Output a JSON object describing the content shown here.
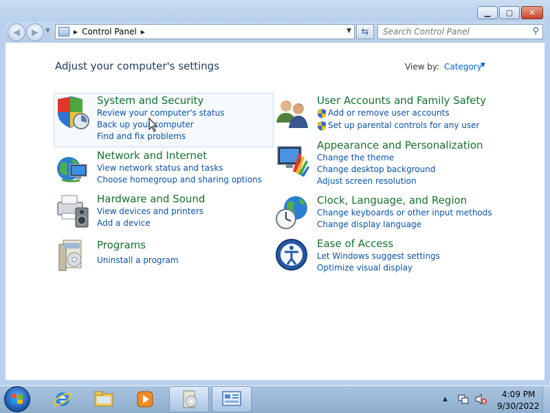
{
  "window": {
    "minimize_glyph": "▁",
    "maximize_glyph": "▢",
    "close_glyph": "✕"
  },
  "nav": {
    "breadcrumb": "Control Panel",
    "search_placeholder": "Search Control Panel"
  },
  "page": {
    "title": "Adjust your computer's settings",
    "view_by_label": "View by:",
    "view_by_value": "Category"
  },
  "categories": [
    {
      "title": "System and Security",
      "links": [
        "Review your computer's status",
        "Back up your computer",
        "Find and fix problems"
      ]
    },
    {
      "title": "Network and Internet",
      "links": [
        "View network status and tasks",
        "Choose homegroup and sharing options"
      ]
    },
    {
      "title": "Hardware and Sound",
      "links": [
        "View devices and printers",
        "Add a device"
      ]
    },
    {
      "title": "Programs",
      "links": [
        "Uninstall a program"
      ]
    },
    {
      "title": "User Accounts and Family Safety",
      "links": [
        "Add or remove user accounts",
        "Set up parental controls for any user"
      ]
    },
    {
      "title": "Appearance and Personalization",
      "links": [
        "Change the theme",
        "Change desktop background",
        "Adjust screen resolution"
      ]
    },
    {
      "title": "Clock, Language, and Region",
      "links": [
        "Change keyboards or other input methods",
        "Change display language"
      ]
    },
    {
      "title": "Ease of Access",
      "links": [
        "Let Windows suggest settings",
        "Optimize visual display"
      ]
    }
  ],
  "taskbar": {
    "time": "4:09 PM",
    "date": "9/30/2022"
  },
  "colors": {
    "category_title": "#15702c",
    "link": "#0a52a8",
    "page_title": "#1e395b"
  }
}
